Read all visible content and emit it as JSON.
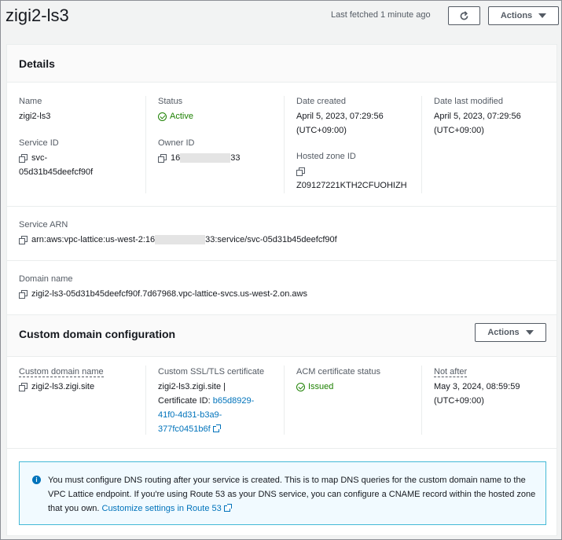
{
  "header": {
    "title": "zigi2-ls3",
    "last_fetched": "Last fetched 1 minute ago",
    "refresh_icon": "refresh-icon",
    "actions_label": "Actions"
  },
  "details": {
    "heading": "Details",
    "name_label": "Name",
    "name_value": "zigi2-ls3",
    "status_label": "Status",
    "status_value": "Active",
    "date_created_label": "Date created",
    "date_created_line1": "April 5, 2023, 07:29:56",
    "date_created_line2": "(UTC+09:00)",
    "date_modified_label": "Date last modified",
    "date_modified_line1": "April 5, 2023, 07:29:56",
    "date_modified_line2": "(UTC+09:00)",
    "service_id_label": "Service ID",
    "service_id_line1": "svc-",
    "service_id_line2": "05d31b45deefcf90f",
    "owner_id_label": "Owner ID",
    "owner_id_prefix": "16",
    "owner_id_suffix": "33",
    "hosted_zone_label": "Hosted zone ID",
    "hosted_zone_value": "Z09127221KTH2CFUOHIZH",
    "service_arn_label": "Service ARN",
    "service_arn_prefix": "arn:aws:vpc-lattice:us-west-2:16",
    "service_arn_suffix": "33:service/svc-05d31b45deefcf90f",
    "domain_name_label": "Domain name",
    "domain_name_value": "zigi2-ls3-05d31b45deefcf90f.7d67968.vpc-lattice-svcs.us-west-2.on.aws"
  },
  "custom_domain": {
    "heading": "Custom domain configuration",
    "actions_label": "Actions",
    "name_label": "Custom domain name",
    "name_value": "zigi2-ls3.zigi.site",
    "cert_label": "Custom SSL/TLS certificate",
    "cert_line1": "zigi2-ls3.zigi.site |",
    "cert_line2_prefix": "Certificate ID:",
    "cert_id_part1": "b65d8929-",
    "cert_id_part2": "41f0-4d31-b3a9-",
    "cert_id_part3": "377fc0451b6f",
    "acm_status_label": "ACM certificate status",
    "acm_status_value": "Issued",
    "not_after_label": "Not after",
    "not_after_line1": "May 3, 2024, 08:59:59",
    "not_after_line2": "(UTC+09:00)"
  },
  "info": {
    "text": "You must configure DNS routing after your service is created. This is to map DNS queries for the custom domain name to the VPC Lattice endpoint. If you're using Route 53 as your DNS service, you can configure a CNAME record within the hosted zone that you own.",
    "link": "Customize settings in Route 53"
  },
  "colors": {
    "accent_link": "#0073bb",
    "success": "#1d8102",
    "info_border": "#44b9d6"
  }
}
